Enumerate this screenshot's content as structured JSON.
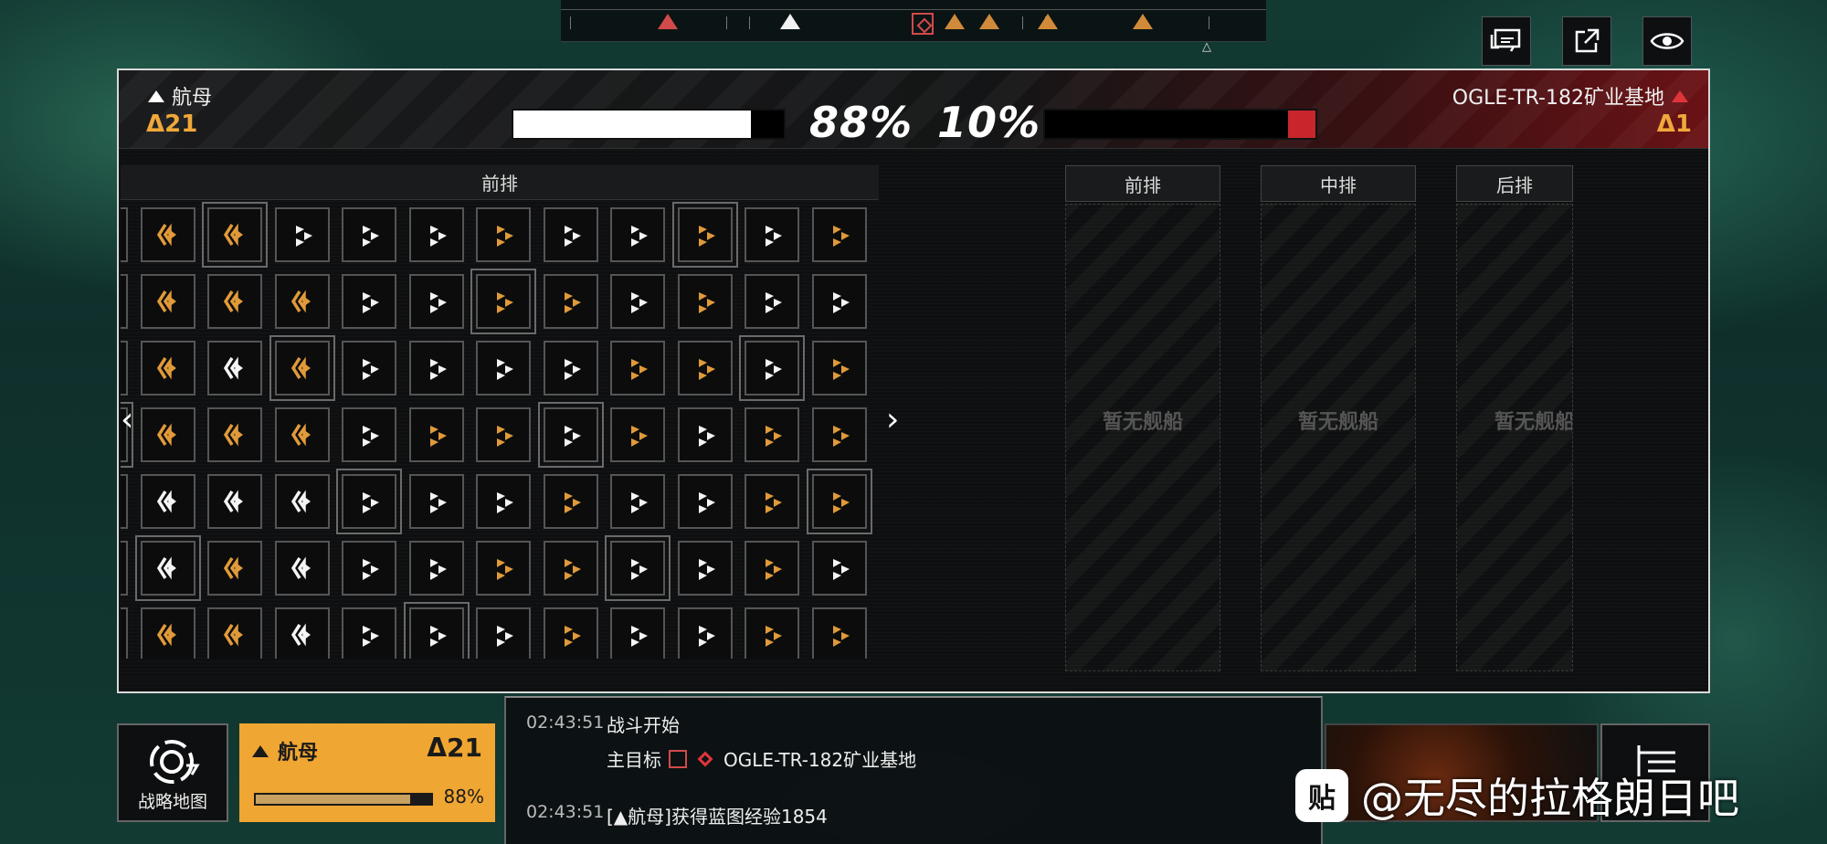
{
  "header": {
    "ally_fleet": "航母",
    "ally_count": "Δ21",
    "ally_percent": "88%",
    "ally_percent_value": 0.88,
    "enemy_name": "OGLE-TR-182矿业基地",
    "enemy_count": "Δ1",
    "enemy_percent": "10%",
    "enemy_percent_value": 0.1
  },
  "grid": {
    "header": "前排",
    "rows": [
      [
        "o",
        "oL",
        "oL",
        "w",
        "w",
        "w",
        "o",
        "w",
        "w",
        "o",
        "w",
        "o"
      ],
      [
        "g",
        "oL",
        "oL",
        "oL",
        "w",
        "w",
        "o",
        "o",
        "w",
        "o",
        "w",
        "w"
      ],
      [
        "o",
        "oL",
        "wL",
        "oL",
        "w",
        "w",
        "w",
        "w",
        "o",
        "o",
        "w",
        "o"
      ],
      [
        "g",
        "oL",
        "oL",
        "oL",
        "w",
        "o",
        "o",
        "w",
        "o",
        "w",
        "o",
        "o"
      ],
      [
        "o",
        "wL",
        "wL",
        "wL",
        "w",
        "w",
        "w",
        "o",
        "w",
        "w",
        "o",
        "o"
      ],
      [
        "o",
        "wL",
        "oL",
        "wL",
        "w",
        "w",
        "o",
        "o",
        "w",
        "w",
        "o",
        "w"
      ],
      [
        "o",
        "oL",
        "oL",
        "wL",
        "w",
        "w",
        "w",
        "o",
        "w",
        "w",
        "o",
        "o"
      ]
    ],
    "colors": {
      "o": "#e09a3a",
      "w": "#f4f4f4",
      "g": "#9a9a9a"
    }
  },
  "formation": {
    "columns": [
      {
        "label": "前排",
        "empty": "暂无舰船"
      },
      {
        "label": "中排",
        "empty": "暂无舰船"
      },
      {
        "label": "后排",
        "empty": "暂无舰船"
      }
    ]
  },
  "bottom": {
    "strategy_label": "战略地图",
    "fleet_name": "航母",
    "fleet_count": "Δ21",
    "fleet_percent": "88%",
    "fleet_hp_value": 0.88
  },
  "log": [
    {
      "time": "02:43:51",
      "text": "战斗开始"
    },
    {
      "time": "",
      "text": "主目标",
      "target": "OGLE-TR-182矿业基地"
    },
    {
      "time": "02:43:51",
      "text": "[▲航母]获得蓝图经验1854"
    }
  ],
  "watermark": {
    "badge": "贴",
    "text": "@无尽的拉格朗日吧"
  },
  "colors": {
    "accent": "#f0a632",
    "enemy": "#c8262c",
    "ally_bar": "#ffffff"
  }
}
